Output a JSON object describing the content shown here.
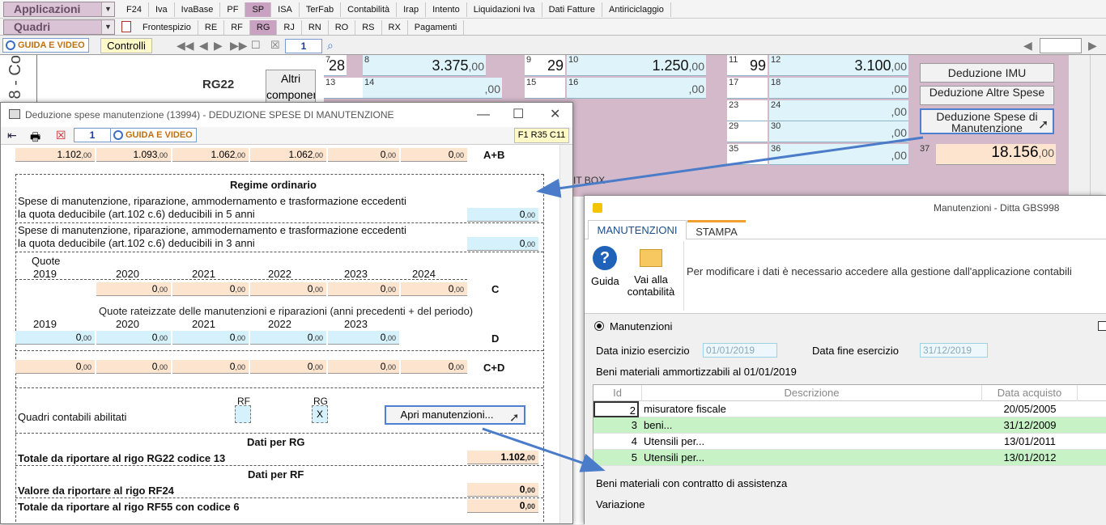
{
  "menubar": {
    "applicazioni": "Applicazioni",
    "quadri": "Quadri",
    "top_tabs": [
      "F24",
      "Iva",
      "IvaBase",
      "PF",
      "SP",
      "ISA",
      "TerFab",
      "Contabilità",
      "Irap",
      "Intento",
      "Liquidazioni Iva",
      "Dati Fatture",
      "Antiriciclaggio"
    ],
    "quadri_tabs": [
      "Frontespizio",
      "RE",
      "RF",
      "RG",
      "RJ",
      "RN",
      "RO",
      "RS",
      "RX",
      "Pagamenti"
    ]
  },
  "toolbar": {
    "guida_video": "GUIDA E VIDEO",
    "controlli": "Controlli",
    "page": "1"
  },
  "background": {
    "vertical_label": "8 - Co",
    "rg22": "RG22",
    "altri_componenti": "Altri componenti",
    "cells": [
      {
        "code": "7",
        "value": "28",
        "dec": ""
      },
      {
        "code": "8",
        "value": "3.375",
        "dec": ",00"
      },
      {
        "code": "9",
        "value": "29",
        "dec": ""
      },
      {
        "code": "10",
        "value": "1.250",
        "dec": ",00"
      },
      {
        "code": "11",
        "value": "99",
        "dec": ""
      },
      {
        "code": "12",
        "value": "3.100",
        "dec": ",00"
      }
    ],
    "codes_row2": [
      "13",
      "14",
      "15",
      "16",
      "17",
      "18"
    ],
    "codes_row3": [
      "23",
      "24"
    ],
    "codes_row4": [
      "29",
      "30"
    ],
    "codes_row5": [
      "35",
      "36"
    ],
    "code37": "37",
    "total": "18.156",
    "total_dec": ",00",
    "deduzione_imu": "Deduzione IMU",
    "deduzione_altre": "Deduzione Altre Spese",
    "deduzione_manut": "Deduzione Spese di Manutenzione",
    "it_box": "IT BOX"
  },
  "window1": {
    "title": "Deduzione spese manutenzione (13994) - DEDUZIONE SPESE DI MANUTENZIONE",
    "page": "1",
    "guida_video": "GUIDA E VIDEO",
    "ref": "F1 R35 C11",
    "row_ab": [
      "1.102",
      "1.093",
      "1.062",
      "1.062",
      "0",
      "0"
    ],
    "label_ab": "A+B",
    "regime": "Regime ordinario",
    "spese5_line1": "Spese di manutenzione, riparazione, ammodernamento e trasformazione eccedenti",
    "spese5_line2": "la quota deducibile (art.102 c.6) deducibili in 5 anni",
    "spese5_value": "0",
    "spese3_line1": "Spese di manutenzione, riparazione, ammodernamento e trasformazione eccedenti",
    "spese3_line2": "la quota deducibile (art.102 c.6) deducibili in 3 anni",
    "spese3_value": "0",
    "quote_label": "Quote",
    "years_c": [
      "2019",
      "2020",
      "2021",
      "2022",
      "2023",
      "2024"
    ],
    "row_c": [
      "0",
      "0",
      "0",
      "0",
      "0"
    ],
    "label_c": "C",
    "quote_rate": "Quote rateizzate delle manutenzioni e riparazioni (anni precedenti + del periodo)",
    "years_d": [
      "2019",
      "2020",
      "2021",
      "2022",
      "2023"
    ],
    "row_d": [
      "0",
      "0",
      "0",
      "0",
      "0"
    ],
    "label_d": "D",
    "row_cd": [
      "0",
      "0",
      "0",
      "0",
      "0",
      "0"
    ],
    "label_cd": "C+D",
    "quadri_abilitati": "Quadri contabili abilitati",
    "rf": "RF",
    "rg": "RG",
    "rg_check": "X",
    "apri": "Apri manutenzioni...",
    "dati_rg": "Dati per RG",
    "totale_rg22": "Totale da riportare al rigo RG22 codice 13",
    "totale_rg22_value": "1.102",
    "dati_rf": "Dati per RF",
    "valore_rf24": "Valore da riportare al rigo RF24",
    "valore_rf24_value": "0",
    "totale_rf55": "Totale da riportare al rigo RF55 con codice 6",
    "totale_rf55_value": "0",
    "dec": ",00"
  },
  "window2": {
    "title": "Manutenzioni - Ditta GBS998",
    "tab_manutenzioni": "MANUTENZIONI",
    "tab_stampa": "STAMPA",
    "guida": "Guida",
    "vai_line1": "Vai alla",
    "vai_line2": "contabilità",
    "info": "Per modificare i dati è necessario accedere alla gestione dall'applicazione contabili",
    "radio_manutenzioni": "Manutenzioni",
    "data_inizio_label": "Data inizio esercizio",
    "data_inizio": "01/01/2019",
    "data_fine_label": "Data fine esercizio",
    "data_fine": "31/12/2019",
    "beni_ammortizzabili": "Beni materiali ammortizzabili al 01/01/2019",
    "grid_headers": [
      "Id",
      "Descrizione",
      "Data acquisto"
    ],
    "rows": [
      {
        "id": "2",
        "descrizione": "misuratore fiscale",
        "data": "20/05/2005"
      },
      {
        "id": "3",
        "descrizione": "beni...",
        "data": "31/12/2009"
      },
      {
        "id": "4",
        "descrizione": "Utensili per...",
        "data": "13/01/2011"
      },
      {
        "id": "5",
        "descrizione": "Utensili per...",
        "data": "13/01/2012"
      }
    ],
    "beni_assistenza": "Beni materiali con contratto di assistenza",
    "variazione": "Variazione"
  },
  "colors": {
    "accent_pink": "#c9a2c2",
    "input_orange": "#fde4cf",
    "input_blue": "#d5f1fb",
    "highlight_blue": "#4f7fcf",
    "row_green": "#c6f2c6"
  }
}
